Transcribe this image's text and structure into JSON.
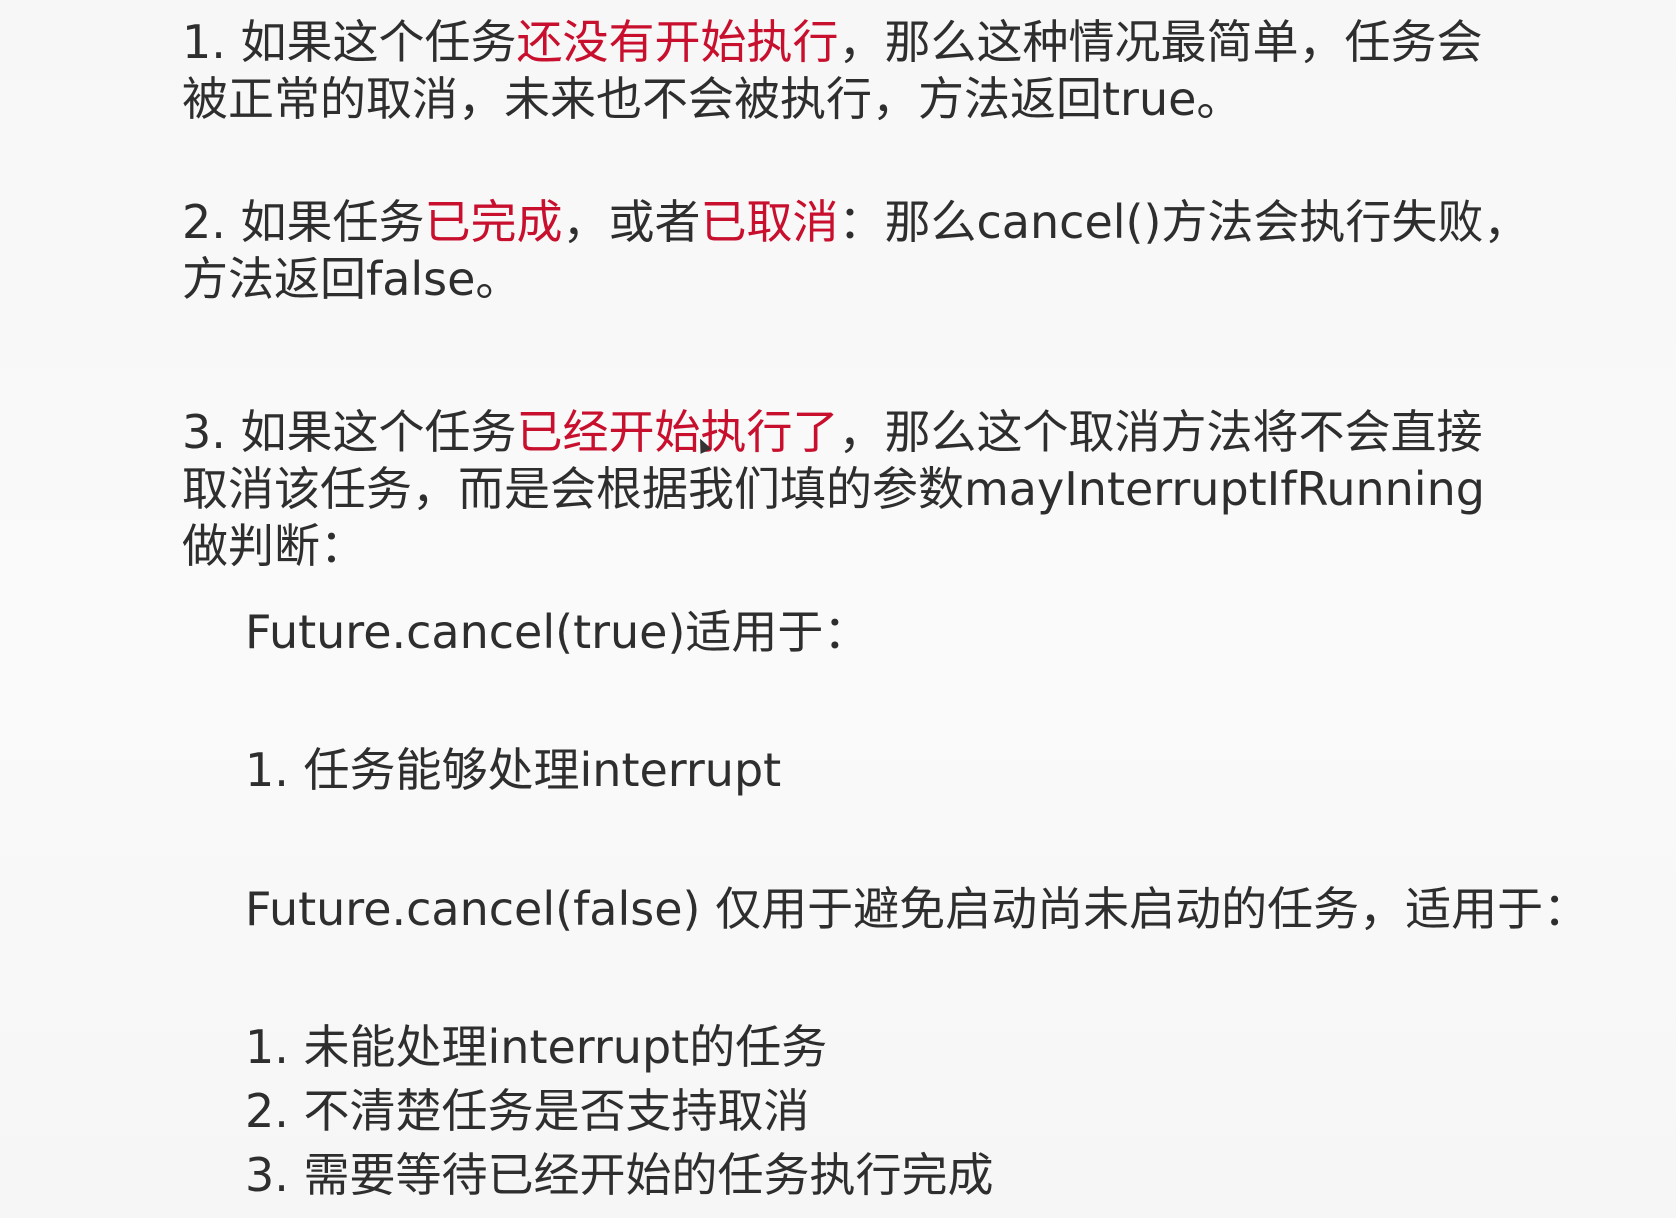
{
  "item1": {
    "line1_a": "1. 如果这个任务",
    "line1_hl": "还没有开始执行",
    "line1_b": "，那么这种情况最简单，任务会",
    "line2": "被正常的取消，未来也不会被执行，方法返回true。"
  },
  "item2": {
    "line1_a": "2. 如果任务",
    "line1_hl1": "已完成",
    "line1_b": "，或者",
    "line1_hl2": "已取消",
    "line1_c": "：那么cancel()方法会执行失败，",
    "line2": "方法返回false。"
  },
  "item3": {
    "line1_a": "3. 如果这个任务",
    "line1_hl": "已经开始执行了",
    "line1_b": "，那么这个取消方法将不会直接",
    "line2": "取消该任务，而是会根据我们填的参数mayInterruptIfRunning",
    "line3": "做判断："
  },
  "cancel_true": {
    "heading": "Future.cancel(true)适用于：",
    "items": [
      "1. 任务能够处理interrupt"
    ]
  },
  "cancel_false": {
    "heading": "Future.cancel(false) 仅用于避免启动尚未启动的任务，适用于：",
    "items": [
      "1. 未能处理interrupt的任务",
      "2. 不清楚任务是否支持取消",
      "3. 需要等待已经开始的任务执行完成"
    ]
  },
  "colors": {
    "highlight": "#c8102e",
    "text": "#2e2e2e",
    "background": "#f9f9f9"
  }
}
